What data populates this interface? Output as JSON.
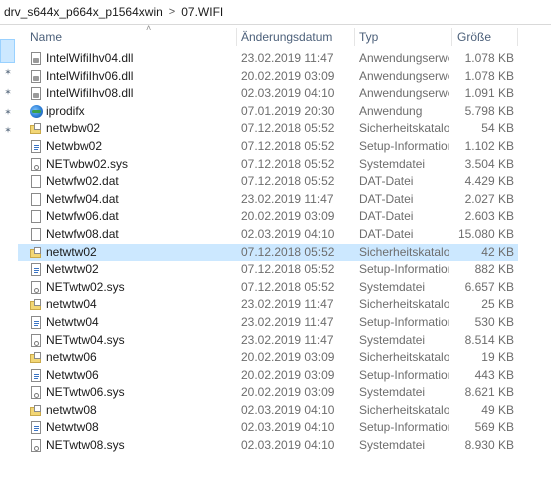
{
  "breadcrumb": {
    "parts": [
      "drv_s644x_p664x_p1564xwin",
      "07.WIFI"
    ],
    "separator": ">"
  },
  "columns": {
    "name": "Name",
    "date": "Änderungsdatum",
    "type": "Typ",
    "size": "Größe"
  },
  "files": [
    {
      "name": "IntelWifiIhv04.dll",
      "date": "23.02.2019 11:47",
      "type": "Anwendungserwei...",
      "size": "1.078 KB",
      "icon": "dll-file-icon"
    },
    {
      "name": "IntelWifiIhv06.dll",
      "date": "20.02.2019 03:09",
      "type": "Anwendungserwei...",
      "size": "1.078 KB",
      "icon": "dll-file-icon"
    },
    {
      "name": "IntelWifiIhv08.dll",
      "date": "02.03.2019 04:10",
      "type": "Anwendungserwei...",
      "size": "1.091 KB",
      "icon": "dll-file-icon"
    },
    {
      "name": "iprodifx",
      "date": "07.01.2019 20:30",
      "type": "Anwendung",
      "size": "5.798 KB",
      "icon": "application-icon"
    },
    {
      "name": "netwbw02",
      "date": "07.12.2018 05:52",
      "type": "Sicherheitskatalog",
      "size": "54 KB",
      "icon": "security-catalog-icon"
    },
    {
      "name": "Netwbw02",
      "date": "07.12.2018 05:52",
      "type": "Setup-Information...",
      "size": "1.102 KB",
      "icon": "setup-information-icon"
    },
    {
      "name": "NETwbw02.sys",
      "date": "07.12.2018 05:52",
      "type": "Systemdatei",
      "size": "3.504 KB",
      "icon": "system-file-icon"
    },
    {
      "name": "Netwfw02.dat",
      "date": "07.12.2018 05:52",
      "type": "DAT-Datei",
      "size": "4.429 KB",
      "icon": "document-icon"
    },
    {
      "name": "Netwfw04.dat",
      "date": "23.02.2019 11:47",
      "type": "DAT-Datei",
      "size": "2.027 KB",
      "icon": "document-icon"
    },
    {
      "name": "Netwfw06.dat",
      "date": "20.02.2019 03:09",
      "type": "DAT-Datei",
      "size": "2.603 KB",
      "icon": "document-icon"
    },
    {
      "name": "Netwfw08.dat",
      "date": "02.03.2019 04:10",
      "type": "DAT-Datei",
      "size": "15.080 KB",
      "icon": "document-icon"
    },
    {
      "name": "netwtw02",
      "date": "07.12.2018 05:52",
      "type": "Sicherheitskatalog",
      "size": "42 KB",
      "icon": "security-catalog-icon",
      "selected": true
    },
    {
      "name": "Netwtw02",
      "date": "07.12.2018 05:52",
      "type": "Setup-Information...",
      "size": "882 KB",
      "icon": "setup-information-icon"
    },
    {
      "name": "NETwtw02.sys",
      "date": "07.12.2018 05:52",
      "type": "Systemdatei",
      "size": "6.657 KB",
      "icon": "system-file-icon"
    },
    {
      "name": "netwtw04",
      "date": "23.02.2019 11:47",
      "type": "Sicherheitskatalog",
      "size": "25 KB",
      "icon": "security-catalog-icon"
    },
    {
      "name": "Netwtw04",
      "date": "23.02.2019 11:47",
      "type": "Setup-Information...",
      "size": "530 KB",
      "icon": "setup-information-icon"
    },
    {
      "name": "NETwtw04.sys",
      "date": "23.02.2019 11:47",
      "type": "Systemdatei",
      "size": "8.514 KB",
      "icon": "system-file-icon"
    },
    {
      "name": "netwtw06",
      "date": "20.02.2019 03:09",
      "type": "Sicherheitskatalog",
      "size": "19 KB",
      "icon": "security-catalog-icon"
    },
    {
      "name": "Netwtw06",
      "date": "20.02.2019 03:09",
      "type": "Setup-Information...",
      "size": "443 KB",
      "icon": "setup-information-icon"
    },
    {
      "name": "NETwtw06.sys",
      "date": "20.02.2019 03:09",
      "type": "Systemdatei",
      "size": "8.621 KB",
      "icon": "system-file-icon"
    },
    {
      "name": "netwtw08",
      "date": "02.03.2019 04:10",
      "type": "Sicherheitskatalog",
      "size": "49 KB",
      "icon": "security-catalog-icon"
    },
    {
      "name": "Netwtw08",
      "date": "02.03.2019 04:10",
      "type": "Setup-Information...",
      "size": "569 KB",
      "icon": "setup-information-icon"
    },
    {
      "name": "NETwtw08.sys",
      "date": "02.03.2019 04:10",
      "type": "Systemdatei",
      "size": "8.930 KB",
      "icon": "system-file-icon"
    }
  ],
  "colors": {
    "selection_bg": "#cce8ff",
    "header_text": "#4c607a",
    "secondary_text": "#6d6d6d"
  }
}
